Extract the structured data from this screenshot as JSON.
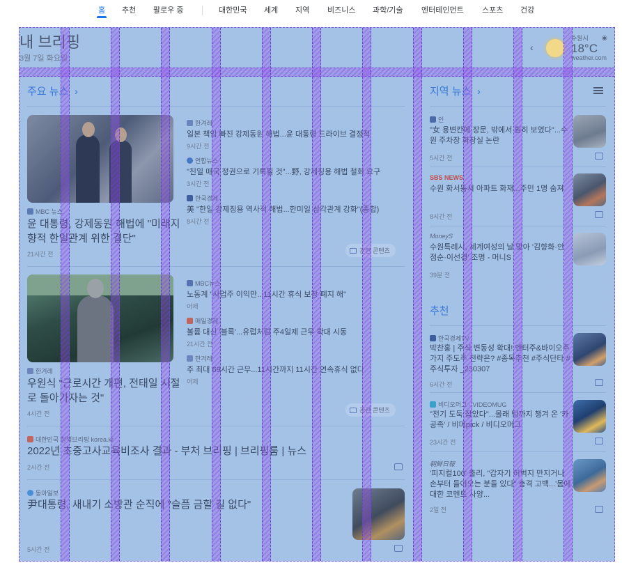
{
  "nav": {
    "tabs": [
      "홈",
      "추천",
      "팔로우 중",
      "대한민국",
      "세계",
      "지역",
      "비즈니스",
      "과학/기술",
      "엔터테인먼트",
      "스포츠",
      "건강"
    ],
    "active": "홈"
  },
  "briefing": {
    "title": "내 브리핑",
    "date": "3월 7일 화요일"
  },
  "weather": {
    "city": "수원시",
    "temp": "18°C",
    "source": "weather.com",
    "prev_arrow": "‹",
    "icon": "sun-icon"
  },
  "top_news": {
    "title": "주요 뉴스",
    "chevron": "›",
    "story1": {
      "source": "MBC 뉴스",
      "headline": "윤 대통령, 강제동원 해법에 \"미래지향적 한일관계 위한 결단\"",
      "time": "21시간 전",
      "related": [
        {
          "source": "한겨레",
          "headline": "일본 책임 빠진 강제동원 해법...윤 대통령 드라이브 결정적",
          "time": "9시간 전"
        },
        {
          "source": "연합뉴스",
          "headline": "\"친일 매국 정권으로 기록될 것\"...野, 강제징용 해법 철회 요구",
          "time": "3시간 전"
        },
        {
          "source": "한국경제",
          "headline": "美 \"한일 강제징용 역사적 해법...한미일 삼각관계 강화\"(종합)",
          "time": "8시간 전"
        }
      ],
      "coverage": "관련 콘텐츠"
    },
    "story2": {
      "source": "한겨레",
      "headline": "우원식 \"근로시간 개편, 전태일 시절로 돌아가자는 것\"",
      "time": "4시간 전",
      "related": [
        {
          "source": "MBC뉴스",
          "headline": "노동계 \"사업주 이익만...11시간 휴식 보장 폐지 해\"",
          "time": "어제"
        },
        {
          "source": "매일경제",
          "headline": "볼륨 대신 '블록'...유럽처럼 주4일제 근무 확대 시동",
          "time": "21시간 전"
        },
        {
          "source": "한겨레",
          "headline": "주 최대 69시간 근무...11시간까지 11시간 연속휴식 없다",
          "time": "어제"
        }
      ],
      "coverage": "관련 콘텐츠"
    },
    "story3": {
      "source": "대한민국 정책브리핑 korea.kr",
      "headline": "2022년 초중고사교육비조사 결과 - 부처 브리핑 | 브리핑룸 | 뉴스",
      "time": "2시간 전"
    },
    "story4": {
      "source": "동아일보",
      "headline": "尹대통령, 새내기 소방관 순직에 \"슬픔 금할 길 없다\"",
      "time": "5시간 전"
    }
  },
  "local_news": {
    "title": "지역 뉴스",
    "chevron": "›",
    "items": [
      {
        "source": "인",
        "headline": "\"女 용변칸에 장문, 밖에서 훤히 보였다\"...수원 주차장 화장실 논란",
        "time": "5시간 전"
      },
      {
        "source": "SBS NEWS",
        "headline": "수원 화서동서 아파트 화재...주민 1명 숨져",
        "time": "8시간 전"
      },
      {
        "source": "MoneyS",
        "headline": "수원특례시, 세계여성의 날 맞아 '김향화·안점순·이선경' 조명 - 머니S",
        "time": "39분 전"
      }
    ]
  },
  "recommended": {
    "title": "추천",
    "items": [
      {
        "source": "한국경제TV",
        "headline": "박찬홍 | 주식 변동성 확대! 엔터주&바이오주 가지 주도주 전략은? #종목추천 #주식단타 #주식투자 _230307",
        "time": "6시간 전"
      },
      {
        "source": "비디오머그 - VIDEOMUG",
        "headline": "\"전기 도둑 잡았다\"...몰래 텀까지 챙겨 온 '카공족' / 비머pick / 비디오머그",
        "time": "23시간 전"
      },
      {
        "source": "朝鮮日報",
        "headline": "'피지컬100' 출리, \"갑자기 허벅지 만지거나 손부터 들어오는 분들 있다\" 충격 고백...'몸에 대한 코멘트 사양...",
        "time": "2일 전"
      }
    ]
  }
}
